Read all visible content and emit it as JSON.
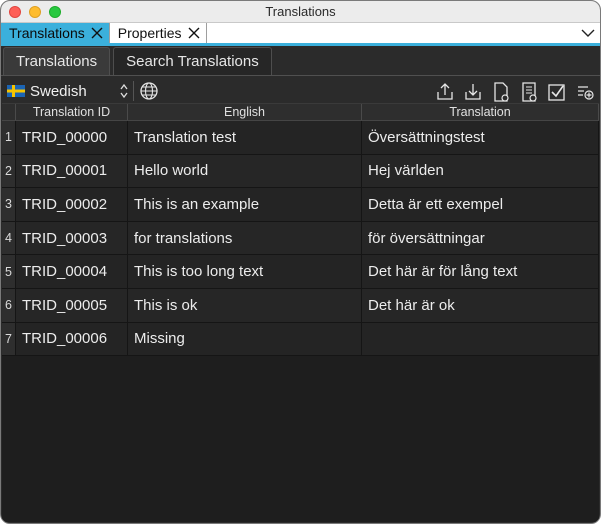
{
  "window": {
    "title": "Translations"
  },
  "doc_tabs": [
    {
      "label": "Translations",
      "active": true
    },
    {
      "label": "Properties",
      "active": false
    }
  ],
  "inner_tabs": [
    {
      "label": "Translations",
      "active": true
    },
    {
      "label": "Search Translations",
      "active": false
    }
  ],
  "toolbar": {
    "language": "Swedish",
    "icons": [
      "globe-icon",
      "export-icon",
      "import-icon",
      "document-settings-icon",
      "document-list-icon",
      "checkbox-icon",
      "add-icon"
    ]
  },
  "table": {
    "headers": {
      "id": "Translation ID",
      "english": "English",
      "translation": "Translation"
    },
    "rows": [
      {
        "num": "1",
        "id": "TRID_00000",
        "english": "Translation test",
        "translation": "Översättningstest"
      },
      {
        "num": "2",
        "id": "TRID_00001",
        "english": "Hello world",
        "translation": "Hej världen"
      },
      {
        "num": "3",
        "id": "TRID_00002",
        "english": "This is an example",
        "translation": "Detta är ett exempel"
      },
      {
        "num": "4",
        "id": "TRID_00003",
        "english": "for translations",
        "translation": "för översättningar"
      },
      {
        "num": "5",
        "id": "TRID_00004",
        "english": "This is too long text",
        "translation": "Det här är för lång text"
      },
      {
        "num": "6",
        "id": "TRID_00005",
        "english": "This is ok",
        "translation": "Det här är ok"
      },
      {
        "num": "7",
        "id": "TRID_00006",
        "english": "Missing",
        "translation": ""
      }
    ]
  },
  "colors": {
    "accent": "#3bb0dc",
    "background": "#2b2b2b",
    "table_background": "#1e1e1e"
  }
}
